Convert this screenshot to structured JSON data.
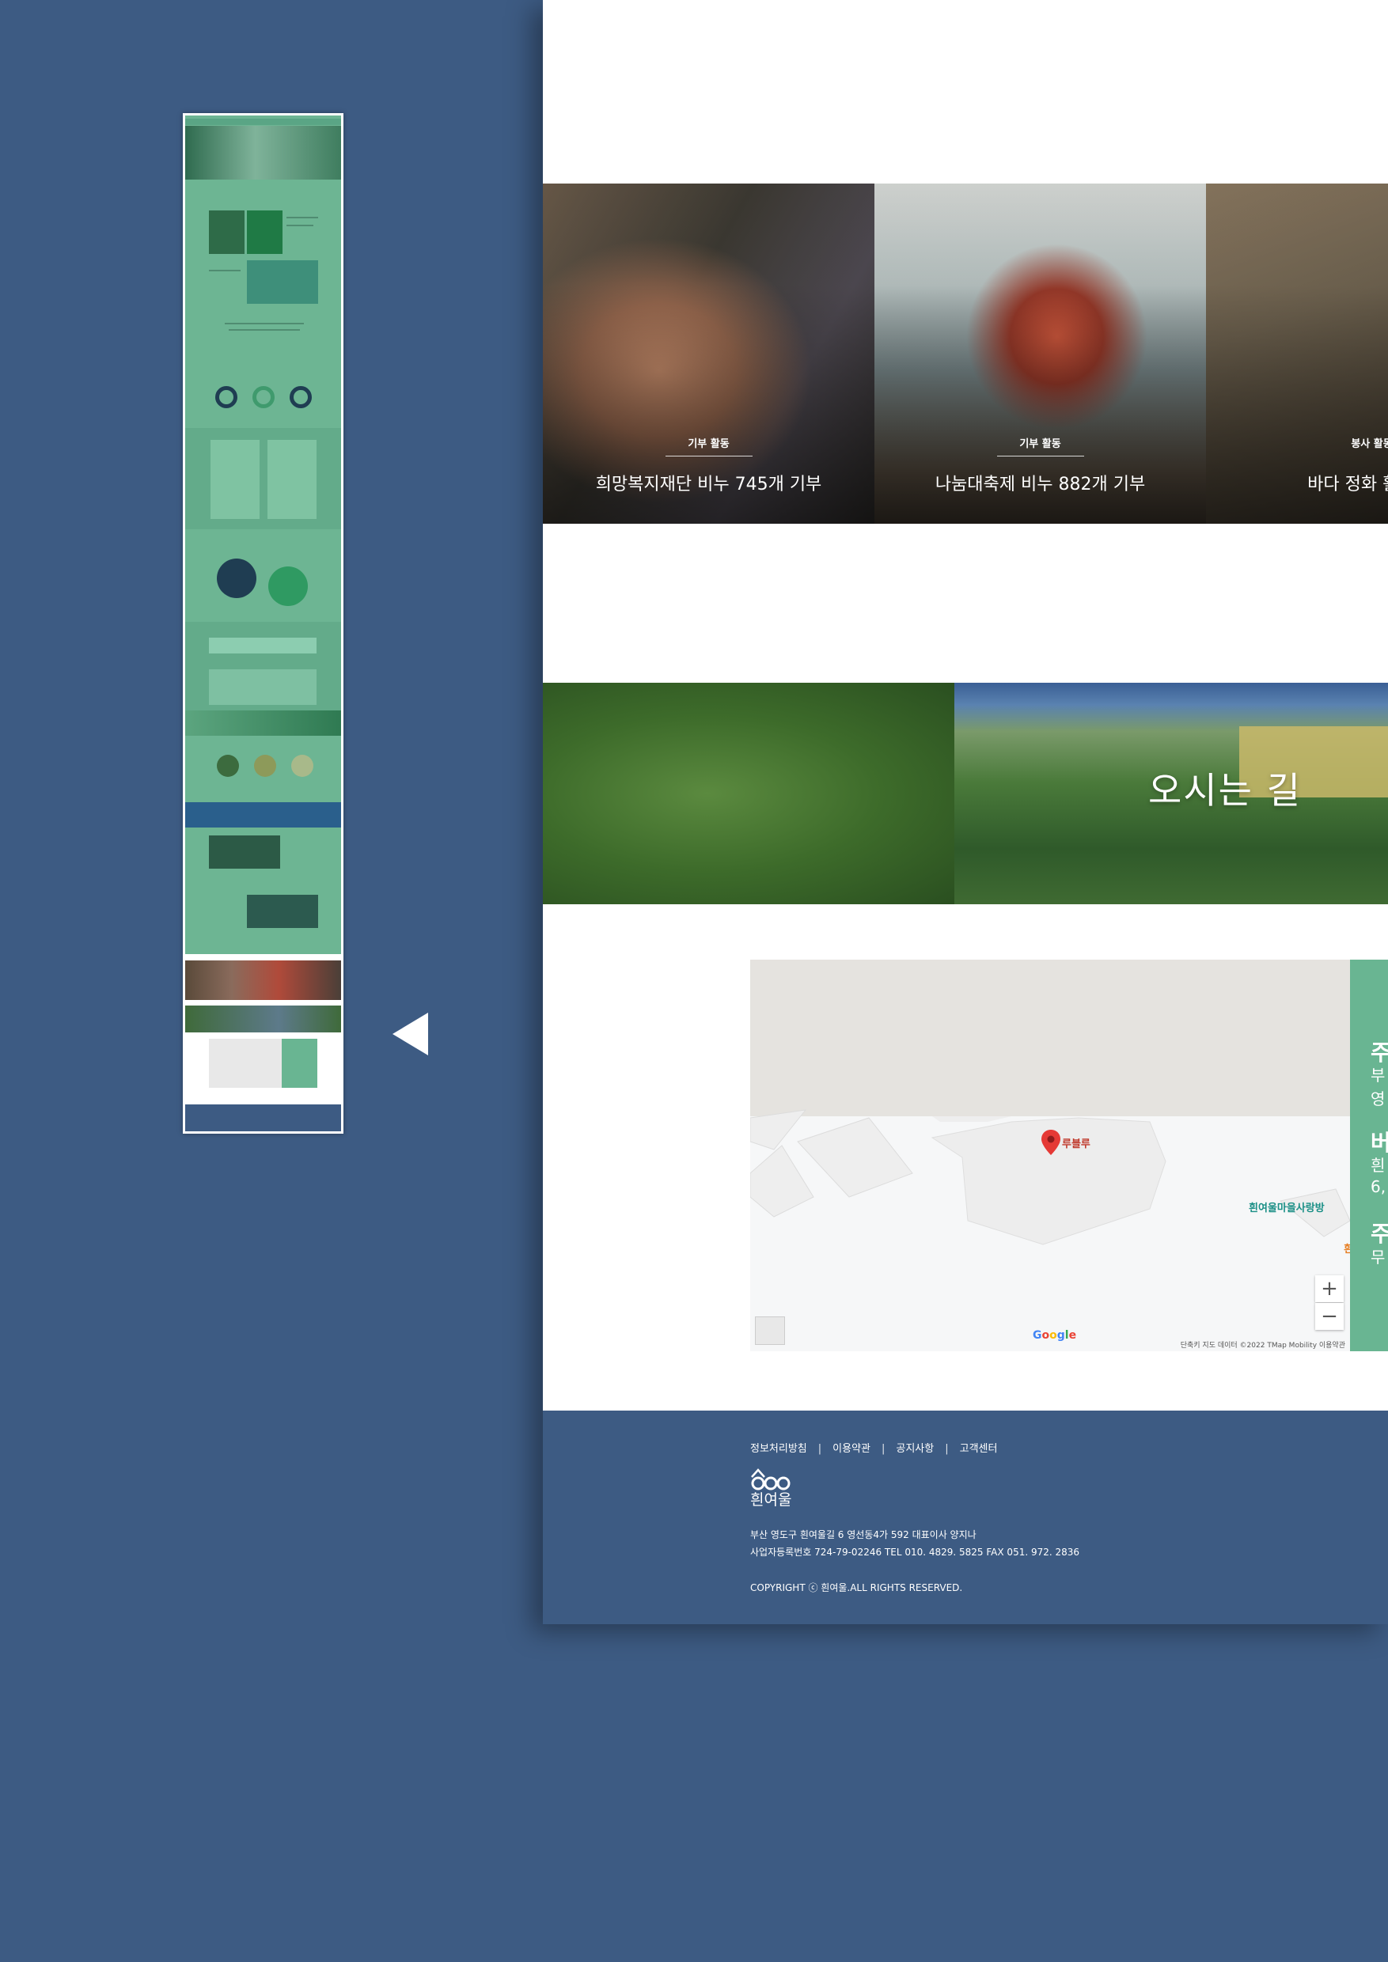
{
  "cards": [
    {
      "tag": "기부 활동",
      "title": "희망복지재단 비누 745개 기부"
    },
    {
      "tag": "기부 활동",
      "title": "나눔대축제 비누 882개 기부"
    },
    {
      "tag": "봉사 활동",
      "title": "바다 정화 활동 참"
    }
  ],
  "directions": {
    "title": "오시는 길"
  },
  "map": {
    "pin_label": "루블루",
    "poi_1": "흰여울마을사랑방",
    "poi_2": "흰",
    "zoom_in": "+",
    "zoom_out": "−",
    "google": "Google",
    "credits": "단축키   지도 데이터 ©2022 TMap Mobility   이용약관"
  },
  "info_panel": {
    "h1": "주",
    "p1a": "부",
    "p1b": "영",
    "h2": "버",
    "p2a": "흰",
    "p2b": "6,",
    "h3": "주",
    "p3a": "무"
  },
  "footer": {
    "links": [
      "정보처리방침",
      "이용약관",
      "공지사항",
      "고객센터"
    ],
    "separator": "|",
    "logo_text": "흰여울",
    "address": "부산 영도구 흰여울길 6 영선동4가 592 대표이사 양지나",
    "business": "사업자등록번호 724-79-02246 TEL 010. 4829. 5825 FAX 051. 972. 2836",
    "copyright": "COPYRIGHT ⓒ 흰여울.ALL RIGHTS RESERVED."
  },
  "colors": {
    "background": "#3d5b83",
    "accent_green": "#69b592",
    "footer": "#3d5b83"
  }
}
